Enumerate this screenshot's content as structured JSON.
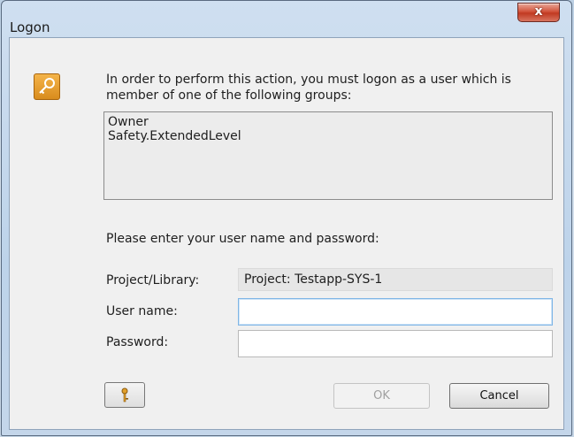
{
  "window": {
    "title": "Logon",
    "close_glyph": "x"
  },
  "dialog": {
    "icon": "key-icon",
    "message": "In order to perform this action, you must logon as a user which is member of one of the following groups:",
    "groups": [
      "Owner",
      "Safety.ExtendedLevel"
    ],
    "prompt": "Please enter your user name and password:",
    "project_label": "Project/Library:",
    "project_value": "Project: Testapp-SYS-1",
    "username_label": "User name:",
    "username_value": "",
    "password_label": "Password:",
    "password_value": ""
  },
  "buttons": {
    "key_icon": "small-key-icon",
    "ok_label": "OK",
    "cancel_label": "Cancel"
  },
  "colors": {
    "accent": "#d98c1d",
    "close": "#c13a22"
  }
}
